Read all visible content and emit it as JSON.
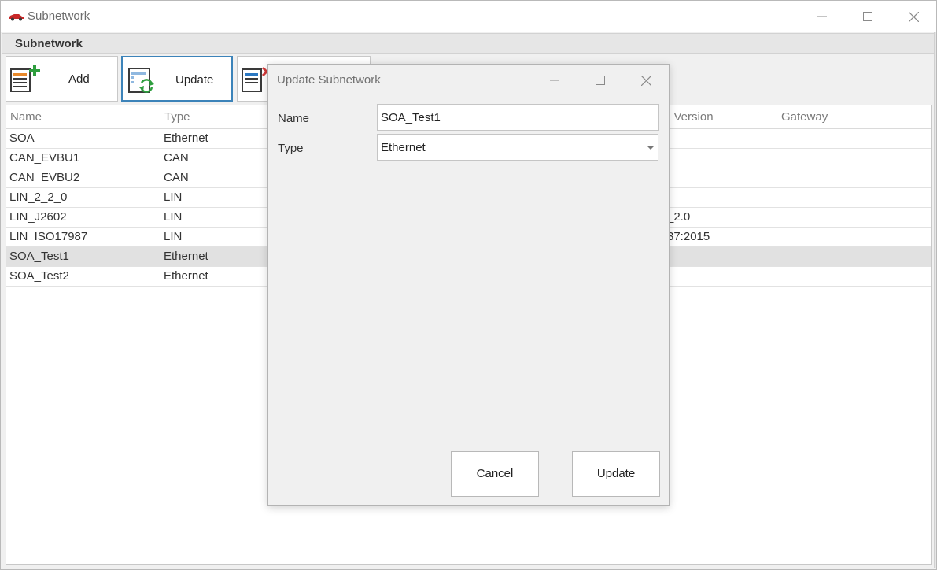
{
  "window": {
    "title": "Subnetwork",
    "group_header": "Subnetwork",
    "controls": {
      "minimize": "minimize-icon",
      "maximize": "maximize-icon",
      "close": "close-icon"
    }
  },
  "toolbar": {
    "add_label": "Add",
    "update_label": "Update",
    "delete_icon": "delete-list-icon"
  },
  "grid": {
    "columns": [
      "Name",
      "Type",
      "l Version",
      "Gateway"
    ],
    "rows": [
      {
        "name": "SOA",
        "type": "Ethernet",
        "version": "",
        "gateway": ""
      },
      {
        "name": "CAN_EVBU1",
        "type": "CAN",
        "version": "",
        "gateway": ""
      },
      {
        "name": "CAN_EVBU2",
        "type": "CAN",
        "version": "",
        "gateway": ""
      },
      {
        "name": "LIN_2_2_0",
        "type": "LIN",
        "version": "",
        "gateway": ""
      },
      {
        "name": "LIN_J2602",
        "type": "LIN",
        "version": "_2.0",
        "gateway": ""
      },
      {
        "name": "LIN_ISO17987",
        "type": "LIN",
        "version": "37:2015",
        "gateway": ""
      },
      {
        "name": "SOA_Test1",
        "type": "Ethernet",
        "version": "",
        "gateway": "",
        "selected": true
      },
      {
        "name": "SOA_Test2",
        "type": "Ethernet",
        "version": "",
        "gateway": ""
      }
    ]
  },
  "dialog": {
    "title": "Update Subnetwork",
    "name_label": "Name",
    "name_value": "SOA_Test1",
    "type_label": "Type",
    "type_value": "Ethernet",
    "cancel_label": "Cancel",
    "update_label": "Update"
  },
  "colors": {
    "accent": "#3c83b9",
    "selected_row": "#e1e1e1",
    "icon_green": "#2e9e3e",
    "icon_blue": "#2b78c2",
    "icon_orange": "#e8892a",
    "icon_red": "#d23a3a"
  }
}
